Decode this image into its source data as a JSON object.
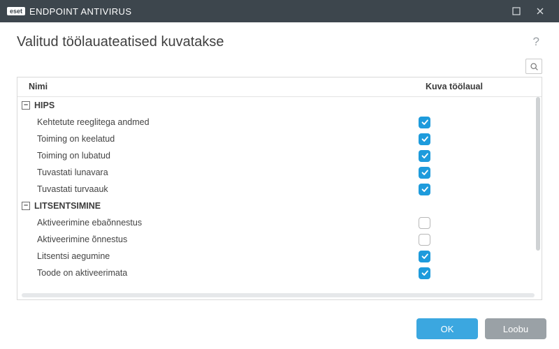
{
  "titlebar": {
    "brand_badge": "eset",
    "brand_text": "ENDPOINT ANTIVIRUS"
  },
  "page": {
    "title": "Valitud töölauateatised kuvatakse"
  },
  "columns": {
    "name": "Nimi",
    "show": "Kuva töölaual"
  },
  "groups": [
    {
      "label": "HIPS",
      "items": [
        {
          "label": "Kehtetute reeglitega andmed",
          "checked": true
        },
        {
          "label": "Toiming on keelatud",
          "checked": true
        },
        {
          "label": "Toiming on lubatud",
          "checked": true
        },
        {
          "label": "Tuvastati lunavara",
          "checked": true
        },
        {
          "label": "Tuvastati turvaauk",
          "checked": true
        }
      ]
    },
    {
      "label": "LITSENTSIMINE",
      "items": [
        {
          "label": "Aktiveerimine ebaõnnestus",
          "checked": false
        },
        {
          "label": "Aktiveerimine õnnestus",
          "checked": false
        },
        {
          "label": "Litsentsi aegumine",
          "checked": true
        },
        {
          "label": "Toode on aktiveerimata",
          "checked": true
        }
      ]
    }
  ],
  "buttons": {
    "ok": "OK",
    "cancel": "Loobu"
  },
  "collapse_glyph": "–"
}
